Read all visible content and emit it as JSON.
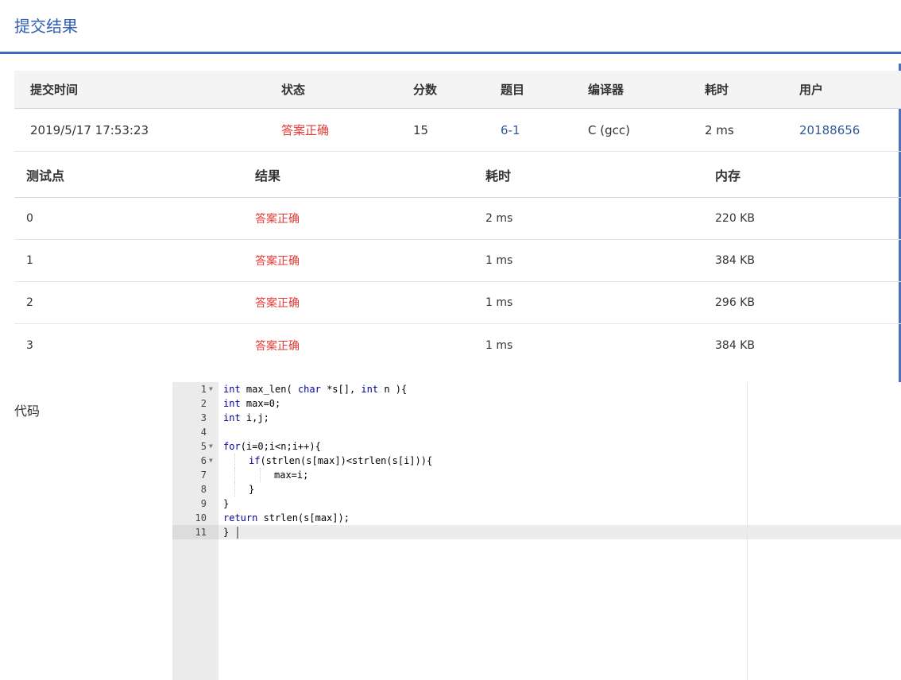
{
  "page": {
    "title": "提交结果"
  },
  "summary": {
    "headers": {
      "time": "提交时间",
      "status": "状态",
      "score": "分数",
      "problem": "题目",
      "compiler": "编译器",
      "duration": "耗时",
      "user": "用户"
    },
    "row": {
      "time": "2019/5/17 17:53:23",
      "status": "答案正确",
      "score": "15",
      "problem": "6-1",
      "compiler": "C (gcc)",
      "duration": "2 ms",
      "user": "20188656"
    }
  },
  "cases": {
    "headers": {
      "case": "测试点",
      "result": "结果",
      "duration": "耗时",
      "memory": "内存"
    },
    "rows": [
      {
        "case": "0",
        "result": "答案正确",
        "duration": "2 ms",
        "memory": "220 KB"
      },
      {
        "case": "1",
        "result": "答案正确",
        "duration": "1 ms",
        "memory": "384 KB"
      },
      {
        "case": "2",
        "result": "答案正确",
        "duration": "1 ms",
        "memory": "296 KB"
      },
      {
        "case": "3",
        "result": "答案正确",
        "duration": "1 ms",
        "memory": "384 KB"
      }
    ]
  },
  "code": {
    "label": "代码",
    "lines": [
      {
        "n": "1",
        "fold": true,
        "indent": 0,
        "tokens": [
          [
            "kw",
            "int"
          ],
          [
            "t",
            " max_len( "
          ],
          [
            "kw",
            "char"
          ],
          [
            "t",
            " *s[], "
          ],
          [
            "kw",
            "int"
          ],
          [
            "t",
            " n ){"
          ]
        ]
      },
      {
        "n": "2",
        "fold": false,
        "indent": 0,
        "tokens": [
          [
            "kw",
            "int"
          ],
          [
            "t",
            " max=0;"
          ]
        ]
      },
      {
        "n": "3",
        "fold": false,
        "indent": 0,
        "tokens": [
          [
            "kw",
            "int"
          ],
          [
            "t",
            " i,j;"
          ]
        ]
      },
      {
        "n": "4",
        "fold": false,
        "indent": 0,
        "tokens": []
      },
      {
        "n": "5",
        "fold": true,
        "indent": 0,
        "tokens": [
          [
            "kw",
            "for"
          ],
          [
            "t",
            "(i=0;i<n;i++){"
          ]
        ]
      },
      {
        "n": "6",
        "fold": true,
        "indent": 1,
        "tokens": [
          [
            "kw",
            "if"
          ],
          [
            "t",
            "(strlen(s[max])<strlen(s[i])){"
          ]
        ]
      },
      {
        "n": "7",
        "fold": false,
        "indent": 2,
        "tokens": [
          [
            "t",
            "max=i;"
          ]
        ]
      },
      {
        "n": "8",
        "fold": false,
        "indent": 1,
        "tokens": [
          [
            "t",
            "}"
          ]
        ]
      },
      {
        "n": "9",
        "fold": false,
        "indent": 0,
        "tokens": [
          [
            "t",
            "}"
          ]
        ]
      },
      {
        "n": "10",
        "fold": false,
        "indent": 0,
        "tokens": [
          [
            "kw",
            "return"
          ],
          [
            "t",
            " strlen(s[max]);"
          ]
        ]
      },
      {
        "n": "11",
        "fold": false,
        "indent": 0,
        "tokens": [
          [
            "t",
            "}"
          ]
        ]
      }
    ]
  },
  "colors": {
    "accent": "#3e6cc2",
    "accepted": "#e53935",
    "link": "#2d5a9c",
    "keyword": "#0000a2"
  }
}
